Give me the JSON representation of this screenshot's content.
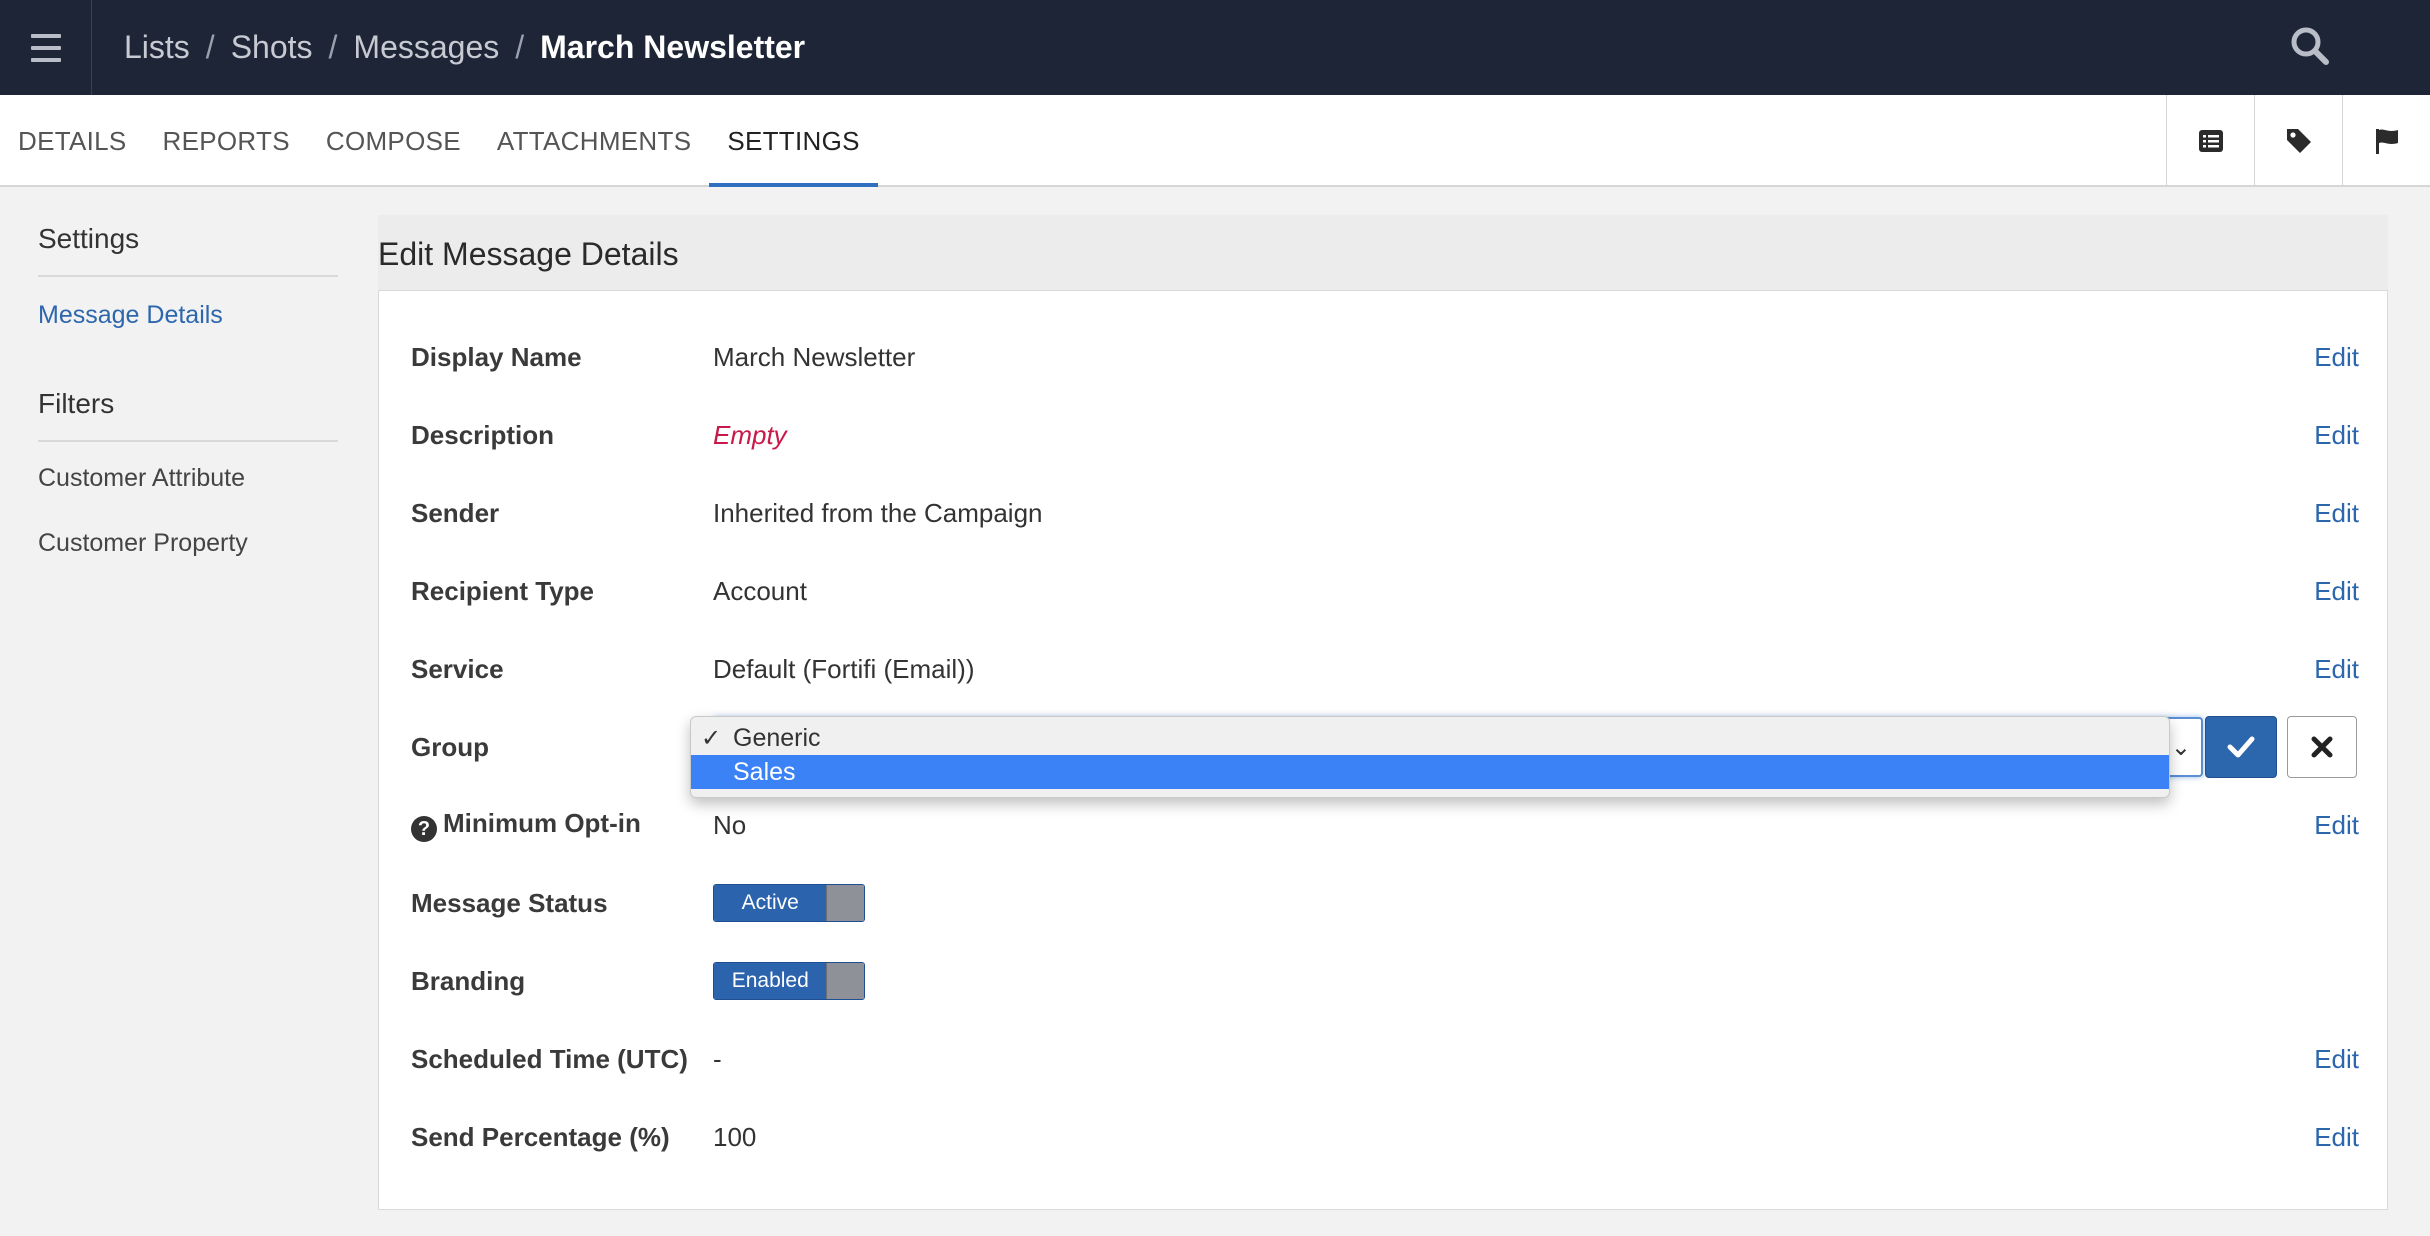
{
  "breadcrumb": {
    "items": [
      "Lists",
      "Shots",
      "Messages"
    ],
    "separator": "/",
    "current": "March Newsletter"
  },
  "tabs": [
    {
      "label": "DETAILS"
    },
    {
      "label": "REPORTS"
    },
    {
      "label": "COMPOSE"
    },
    {
      "label": "ATTACHMENTS"
    },
    {
      "label": "SETTINGS",
      "active": true
    }
  ],
  "tab_actions": [
    "list-icon",
    "tag-icon",
    "flag-icon"
  ],
  "sidebar": {
    "settings_heading": "Settings",
    "settings_items": [
      "Message Details"
    ],
    "filters_heading": "Filters",
    "filter_items": [
      "Customer Attribute",
      "Customer Property"
    ]
  },
  "panel": {
    "title": "Edit Message Details",
    "edit_label": "Edit",
    "rows": [
      {
        "label": "Display Name",
        "value": "March Newsletter"
      },
      {
        "label": "Description",
        "value": "Empty"
      },
      {
        "label": "Sender",
        "value": "Inherited from the Campaign"
      },
      {
        "label": "Recipient Type",
        "value": "Account"
      },
      {
        "label": "Service",
        "value": "Default (Fortifi (Email))"
      },
      {
        "label": "Group"
      },
      {
        "label": "Minimum Opt-in",
        "value": "No"
      },
      {
        "label": "Message Status",
        "toggle": "Active"
      },
      {
        "label": "Branding",
        "toggle": "Enabled"
      },
      {
        "label": "Scheduled Time (UTC)",
        "value": "-"
      },
      {
        "label": "Send Percentage (%)",
        "value": "100"
      }
    ],
    "group_options": [
      "Generic",
      "Sales"
    ],
    "group_checked": "Generic",
    "group_highlighted": "Sales"
  },
  "colors": {
    "topbar": "#1e2536",
    "accent": "#2c66ad",
    "empty_text": "#c9184a",
    "dropdown_highlight": "#3b82f6"
  }
}
